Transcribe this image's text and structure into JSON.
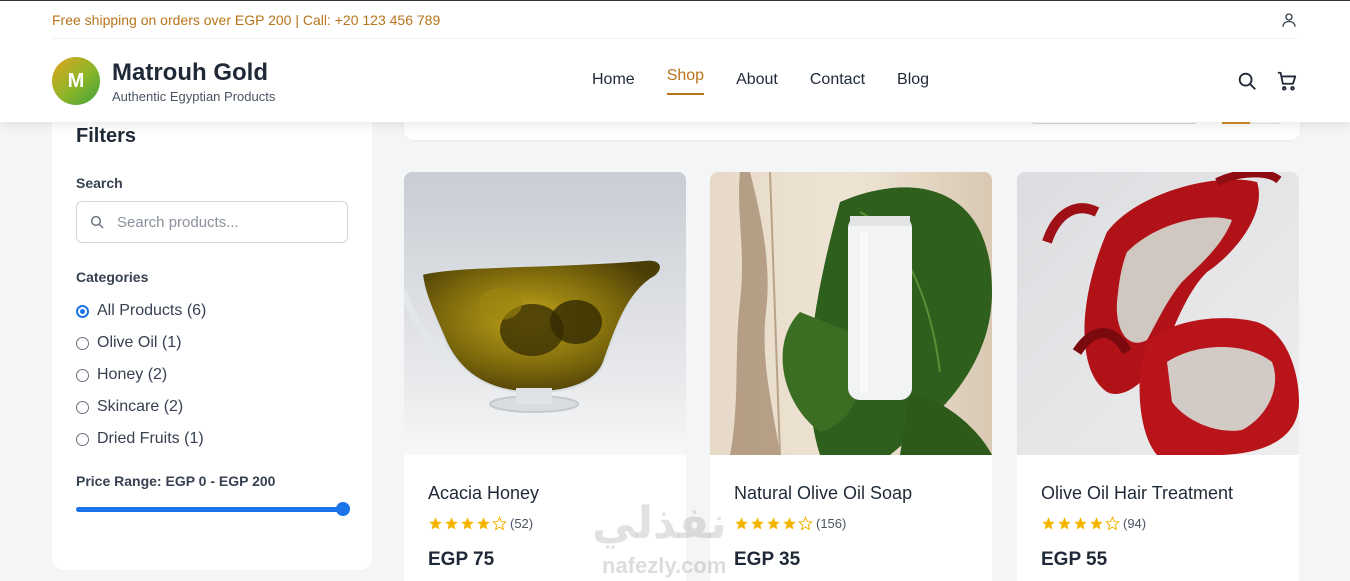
{
  "topbar": {
    "text": "Free shipping on orders over EGP 200 | Call: +20 123 456 789"
  },
  "brand": {
    "logo_letter": "M",
    "name": "Matrouh Gold",
    "tagline": "Authentic Egyptian Products"
  },
  "nav": [
    {
      "label": "Home",
      "active": false
    },
    {
      "label": "Shop",
      "active": true
    },
    {
      "label": "About",
      "active": false
    },
    {
      "label": "Contact",
      "active": false
    },
    {
      "label": "Blog",
      "active": false
    }
  ],
  "filters": {
    "title": "Filters",
    "search_label": "Search",
    "search_placeholder": "Search products...",
    "search_value": "",
    "categories_label": "Categories",
    "categories": [
      {
        "label": "All Products (6)",
        "selected": true
      },
      {
        "label": "Olive Oil (1)",
        "selected": false
      },
      {
        "label": "Honey (2)",
        "selected": false
      },
      {
        "label": "Skincare (2)",
        "selected": false
      },
      {
        "label": "Dried Fruits (1)",
        "selected": false
      }
    ],
    "price_label": "Price Range: EGP 0 - EGP 200",
    "price_value_fraction": 1.0
  },
  "products": [
    {
      "name": "Acacia Honey",
      "rating": 4,
      "reviews": "(52)",
      "price": "EGP 75",
      "image": "olive-oil-gravy-boat"
    },
    {
      "name": "Natural Olive Oil Soap",
      "rating": 4,
      "reviews": "(156)",
      "price": "EGP 35",
      "image": "white-tube-on-leaves"
    },
    {
      "name": "Olive Oil Hair Treatment",
      "rating": 4,
      "reviews": "(94)",
      "price": "EGP 55",
      "image": "red-high-heels"
    }
  ],
  "watermark": {
    "text": "نفذلي",
    "sub": "nafezly.com"
  },
  "colors": {
    "accent": "#b8741a",
    "primary": "#1a73e8",
    "star": "#f5b400"
  }
}
